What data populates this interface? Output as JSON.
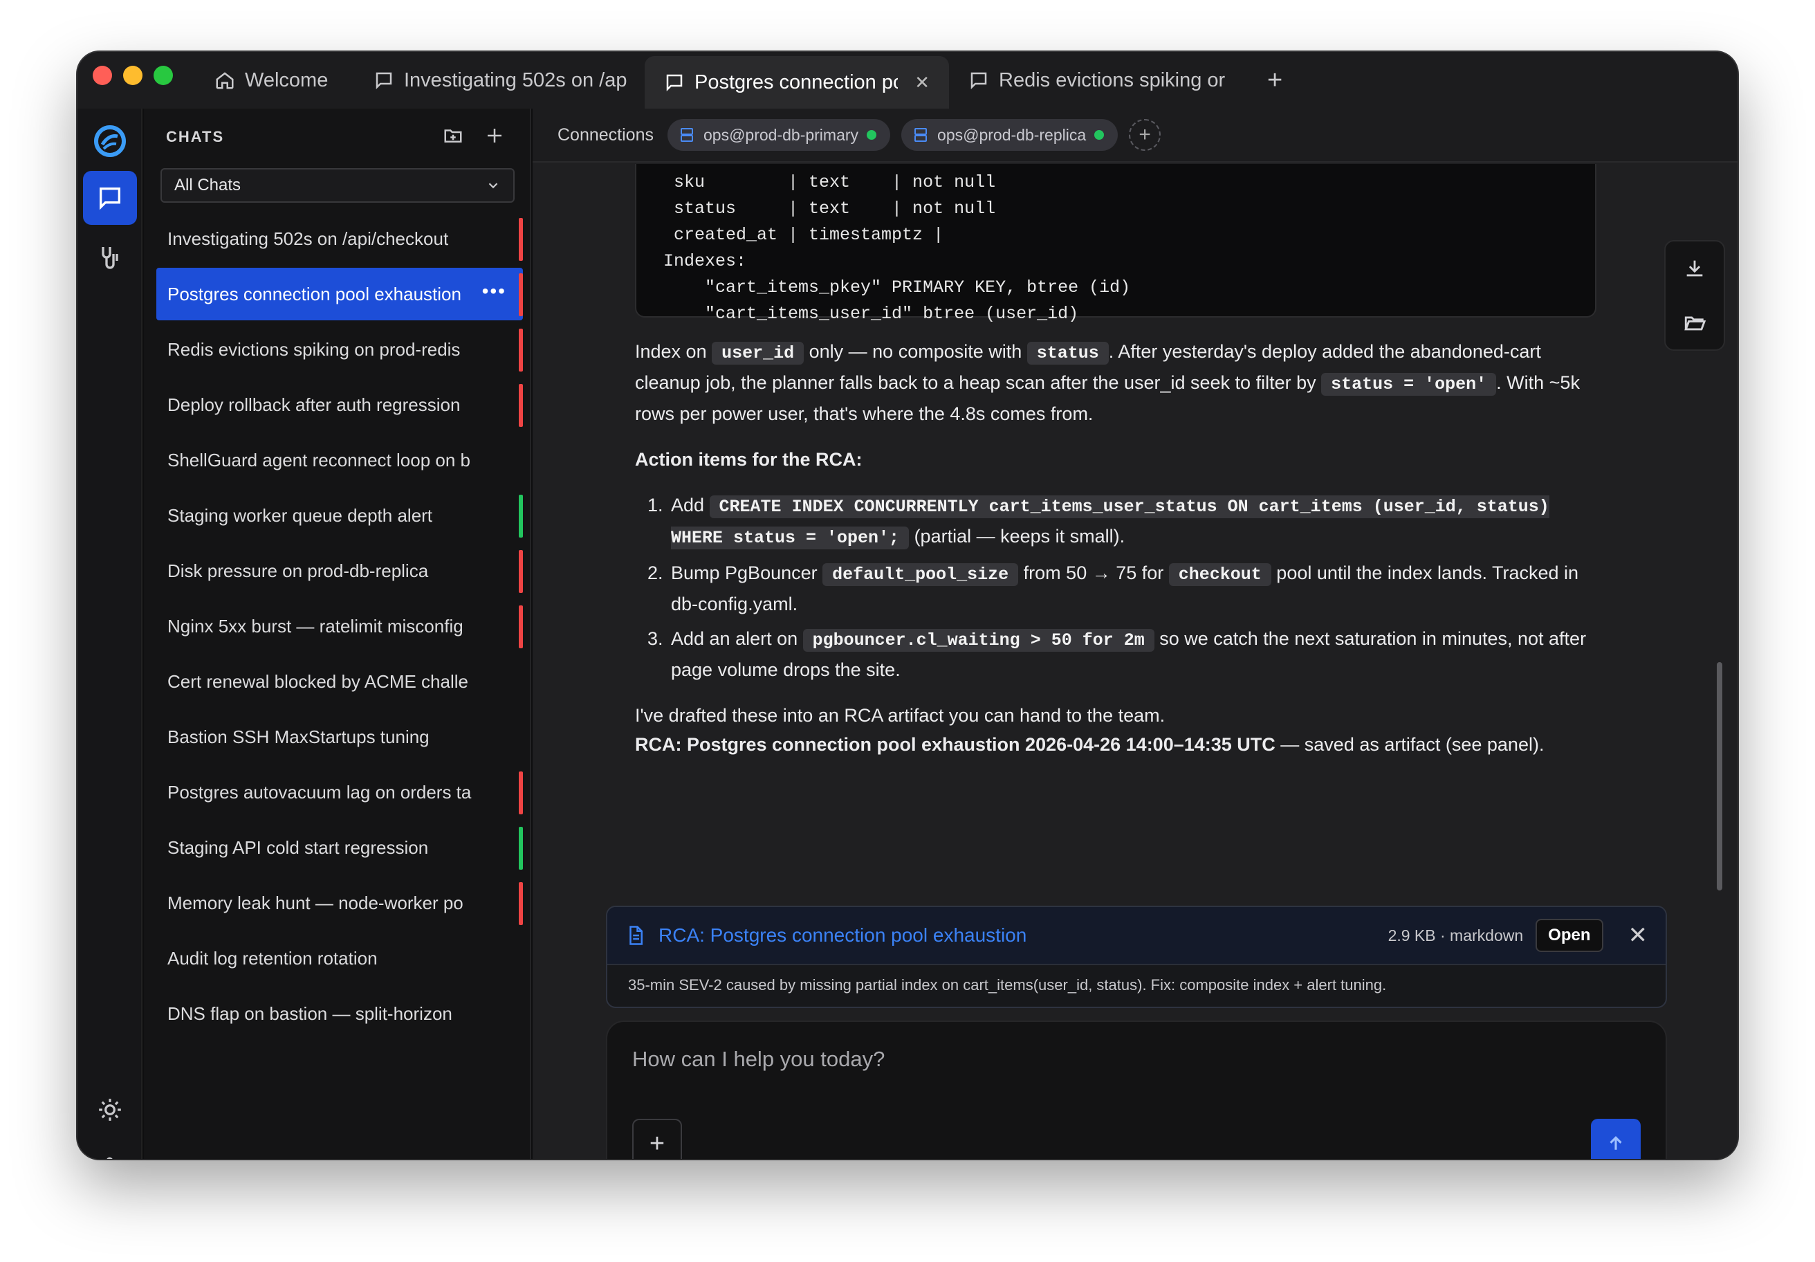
{
  "window": {
    "traffic_colors": [
      "#ff5f57",
      "#febc2e",
      "#28c840"
    ]
  },
  "tabs": [
    {
      "label": "Welcome",
      "icon": "home-icon"
    },
    {
      "label": "Investigating 502s on /ap",
      "icon": "chat-icon"
    },
    {
      "label": "Postgres connection pool",
      "icon": "chat-icon",
      "active": true
    },
    {
      "label": "Redis evictions spiking or",
      "icon": "chat-icon"
    }
  ],
  "sidebar": {
    "heading": "CHATS",
    "filter": "All Chats",
    "chats": [
      {
        "label": "Investigating 502s on /api/checkout",
        "status": "#ef4444"
      },
      {
        "label": "Postgres connection pool exhaustion",
        "status": "#ef4444",
        "active": true
      },
      {
        "label": "Redis evictions spiking on prod-redis",
        "status": "#ef4444"
      },
      {
        "label": "Deploy rollback after auth regression",
        "status": "#ef4444"
      },
      {
        "label": "ShellGuard agent reconnect loop on b",
        "status": ""
      },
      {
        "label": "Staging worker queue depth alert",
        "status": "#22c55e"
      },
      {
        "label": "Disk pressure on prod-db-replica",
        "status": "#ef4444"
      },
      {
        "label": "Nginx 5xx burst — ratelimit misconfig",
        "status": "#ef4444"
      },
      {
        "label": "Cert renewal blocked by ACME challe",
        "status": ""
      },
      {
        "label": "Bastion SSH MaxStartups tuning",
        "status": ""
      },
      {
        "label": "Postgres autovacuum lag on orders ta",
        "status": "#ef4444"
      },
      {
        "label": "Staging API cold start regression",
        "status": "#22c55e"
      },
      {
        "label": "Memory leak hunt — node-worker po",
        "status": "#ef4444"
      },
      {
        "label": "Audit log retention rotation",
        "status": ""
      },
      {
        "label": "DNS flap on bastion — split-horizon",
        "status": ""
      }
    ]
  },
  "connections": {
    "label": "Connections",
    "items": [
      "ops@prod-db-primary",
      "ops@prod-db-replica"
    ]
  },
  "message": {
    "code_lines": [
      "  sku        | text    | not null",
      "  status     | text    | not null",
      "  created_at | timestamptz |",
      " Indexes:",
      "     \"cart_items_pkey\" PRIMARY KEY, btree (id)",
      "     \"cart_items_user_id\" btree (user_id)"
    ],
    "p1": {
      "t1": "Index on ",
      "c1": "user_id",
      "t2": " only — no composite with ",
      "c2": "status",
      "t3": ". After yesterday's deploy added the abandoned-cart cleanup job, the planner falls back to a heap scan after the user_id seek to filter by ",
      "c3": "status = 'open'",
      "t4": ". With ~5k rows per power user, that's where the 4.8s comes from."
    },
    "action_heading": "Action items for the RCA:",
    "item1": {
      "t1": "Add ",
      "c1": "CREATE INDEX CONCURRENTLY cart_items_user_status ON cart_items (user_id, status) WHERE status = 'open';",
      "t2": " (partial — keeps it small)."
    },
    "item2": {
      "t1": "Bump PgBouncer ",
      "c1": "default_pool_size",
      "t2": " from 50 → 75 for ",
      "c2": "checkout",
      "t3": " pool until the index lands. Tracked in db-config.yaml."
    },
    "item3": {
      "t1": "Add an alert on ",
      "c1": "pgbouncer.cl_waiting > 50 for 2m",
      "t2": " so we catch the next saturation in minutes, not after page volume drops the site."
    },
    "p2": "I've drafted these into an RCA artifact you can hand to the team.",
    "p3_bold": "RCA: Postgres connection pool exhaustion 2026-04-26 14:00–14:35 UTC",
    "p3_rest": " — saved as artifact (see panel)."
  },
  "artifact": {
    "title": "RCA: Postgres connection pool exhaustion",
    "meta": "2.9 KB · markdown",
    "open_label": "Open",
    "description": "35-min SEV-2 caused by missing partial index on cart_items(user_id, status). Fix: composite index + alert tuning."
  },
  "composer": {
    "placeholder": "How can I help you today?"
  },
  "colors": {
    "accent": "#1d4ed8",
    "link": "#3b82f6",
    "ok": "#22c55e",
    "error": "#ef4444"
  }
}
